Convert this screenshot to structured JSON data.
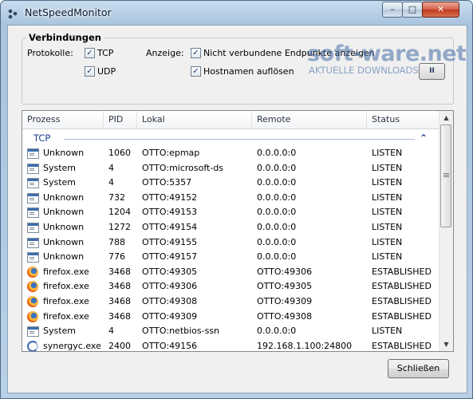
{
  "window": {
    "title": "NetSpeedMonitor",
    "minimize": "–",
    "maximize": "□",
    "close": "✕"
  },
  "watermark": {
    "brand": "soft-ware.net",
    "tagline": "AKTUELLE DOWNLOADS"
  },
  "connections": {
    "group_title": "Verbindungen",
    "protocols_label": "Protokolle:",
    "tcp_label": "TCP",
    "udp_label": "UDP",
    "display_label": "Anzeige:",
    "show_unconnected_label": "Nicht verbundene Endpunkte anzeigen",
    "resolve_hostnames_label": "Hostnamen auflösen",
    "checked_glyph": "✓",
    "pause_glyph": "II"
  },
  "table": {
    "columns": [
      "Prozess",
      "PID",
      "Lokal",
      "Remote",
      "Status"
    ],
    "group": {
      "name": "TCP",
      "chevron": "⌃"
    },
    "rows": [
      {
        "icon": "system-window-icon",
        "process": "Unknown",
        "pid": "1060",
        "local": "OTTO:epmap",
        "remote": "0.0.0.0:0",
        "status": "LISTEN"
      },
      {
        "icon": "system-window-icon",
        "process": "System",
        "pid": "4",
        "local": "OTTO:microsoft-ds",
        "remote": "0.0.0.0:0",
        "status": "LISTEN"
      },
      {
        "icon": "system-window-icon",
        "process": "System",
        "pid": "4",
        "local": "OTTO:5357",
        "remote": "0.0.0.0:0",
        "status": "LISTEN"
      },
      {
        "icon": "system-window-icon",
        "process": "Unknown",
        "pid": "732",
        "local": "OTTO:49152",
        "remote": "0.0.0.0:0",
        "status": "LISTEN"
      },
      {
        "icon": "system-window-icon",
        "process": "Unknown",
        "pid": "1204",
        "local": "OTTO:49153",
        "remote": "0.0.0.0:0",
        "status": "LISTEN"
      },
      {
        "icon": "system-window-icon",
        "process": "Unknown",
        "pid": "1272",
        "local": "OTTO:49154",
        "remote": "0.0.0.0:0",
        "status": "LISTEN"
      },
      {
        "icon": "system-window-icon",
        "process": "Unknown",
        "pid": "788",
        "local": "OTTO:49155",
        "remote": "0.0.0.0:0",
        "status": "LISTEN"
      },
      {
        "icon": "system-window-icon",
        "process": "Unknown",
        "pid": "776",
        "local": "OTTO:49157",
        "remote": "0.0.0.0:0",
        "status": "LISTEN"
      },
      {
        "icon": "firefox-icon",
        "process": "firefox.exe",
        "pid": "3468",
        "local": "OTTO:49305",
        "remote": "OTTO:49306",
        "status": "ESTABLISHED"
      },
      {
        "icon": "firefox-icon",
        "process": "firefox.exe",
        "pid": "3468",
        "local": "OTTO:49306",
        "remote": "OTTO:49305",
        "status": "ESTABLISHED"
      },
      {
        "icon": "firefox-icon",
        "process": "firefox.exe",
        "pid": "3468",
        "local": "OTTO:49308",
        "remote": "OTTO:49309",
        "status": "ESTABLISHED"
      },
      {
        "icon": "firefox-icon",
        "process": "firefox.exe",
        "pid": "3468",
        "local": "OTTO:49309",
        "remote": "OTTO:49308",
        "status": "ESTABLISHED"
      },
      {
        "icon": "system-window-icon",
        "process": "System",
        "pid": "4",
        "local": "OTTO:netbios-ssn",
        "remote": "0.0.0.0:0",
        "status": "LISTEN"
      },
      {
        "icon": "synergy-icon",
        "process": "synergyc.exe",
        "pid": "2400",
        "local": "OTTO:49156",
        "remote": "192.168.1.100:24800",
        "status": "ESTABLISHED"
      }
    ]
  },
  "scrollbar": {
    "up_glyph": "▲",
    "down_glyph": "▼"
  },
  "footer": {
    "close_label": "Schließen"
  }
}
